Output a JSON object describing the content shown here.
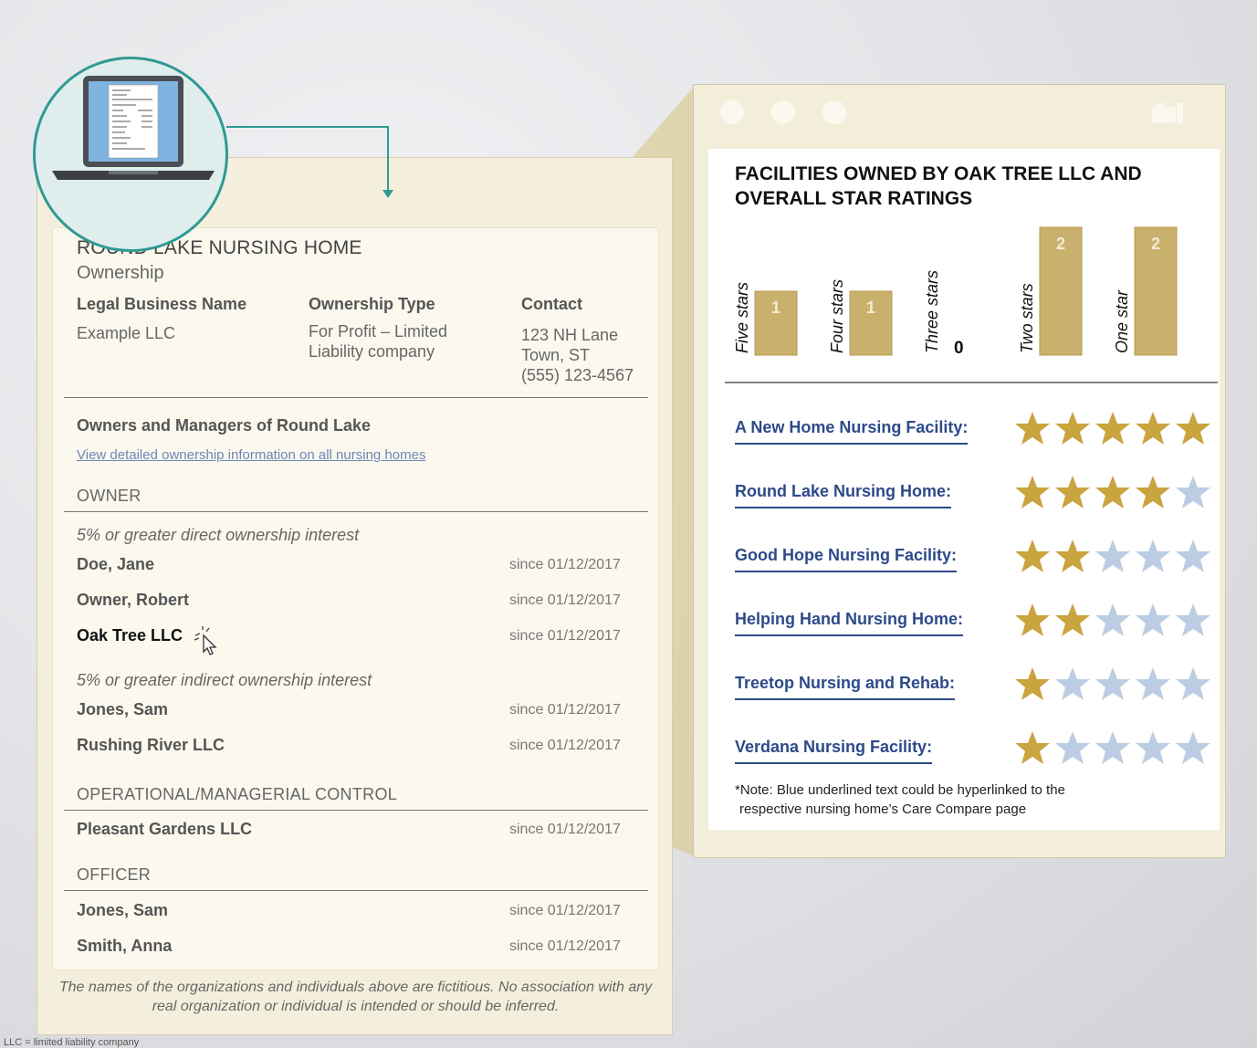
{
  "facility": {
    "title": "ROUND LAKE NURSING HOME",
    "section": "Ownership",
    "columns": [
      {
        "header": "Legal Business Name",
        "lines": [
          "Example LLC"
        ]
      },
      {
        "header": "Ownership Type",
        "lines": [
          "For Profit – Limited",
          "Liability company"
        ]
      },
      {
        "header": "Contact",
        "lines": [
          "123 NH Lane",
          "Town, ST",
          "(555) 123-4567"
        ]
      }
    ]
  },
  "owners_section": {
    "title": "Owners and Managers of Round Lake",
    "link": "View detailed ownership information on all nursing homes",
    "owner_heading": "OWNER",
    "direct_heading": "5% or greater direct ownership interest",
    "direct": [
      {
        "name": "Doe, Jane",
        "since": "since 01/12/2017"
      },
      {
        "name": "Owner, Robert",
        "since": "since 01/12/2017"
      },
      {
        "name": "Oak Tree LLC",
        "since": "since 01/12/2017"
      }
    ],
    "indirect_heading": "5% or greater indirect ownership interest",
    "indirect": [
      {
        "name": "Jones, Sam",
        "since": "since 01/12/2017"
      },
      {
        "name": "Rushing River LLC",
        "since": "since 01/12/2017"
      }
    ],
    "operational_heading": "OPERATIONAL/MANAGERIAL CONTROL",
    "operational": [
      {
        "name": "Pleasant Gardens LLC",
        "since": "since 01/12/2017"
      }
    ],
    "officer_heading": "OFFICER",
    "officers": [
      {
        "name": "Jones, Sam",
        "since": "since 01/12/2017"
      },
      {
        "name": "Smith, Anna",
        "since": "since 01/12/2017"
      }
    ]
  },
  "disclaimer": "The names of the organizations and individuals above are fictitious. No association with any real organization or individual is intended or should be inferred.",
  "footnote": "LLC = limited liability company",
  "popup": {
    "title": "FACILITIES OWNED BY OAK TREE LLC AND OVERALL STAR RATINGS",
    "facilities": [
      {
        "name": "A New Home Nursing Facility:",
        "rating": 5
      },
      {
        "name": "Round Lake Nursing Home:",
        "rating": 4
      },
      {
        "name": "Good Hope Nursing Facility:",
        "rating": 2
      },
      {
        "name": "Helping Hand Nursing Home:",
        "rating": 2
      },
      {
        "name": "Treetop Nursing and Rehab:",
        "rating": 1
      },
      {
        "name": "Verdana Nursing Facility:",
        "rating": 1
      }
    ],
    "note_lines": [
      "*Note: Blue underlined text could be hyperlinked to the",
      "respective nursing home’s Care Compare page"
    ]
  },
  "chart_data": {
    "type": "bar",
    "title": "FACILITIES OWNED BY OAK TREE LLC AND OVERALL STAR RATINGS",
    "categories": [
      "Five stars",
      "Four stars",
      "Three stars",
      "Two stars",
      "One star"
    ],
    "values": [
      1,
      1,
      0,
      2,
      2
    ],
    "value_labels": [
      "1",
      "1",
      "0",
      "2",
      "2"
    ],
    "ylim": [
      0,
      2
    ],
    "grid": false,
    "legend": "none"
  },
  "colors": {
    "bar": "#c9b06d",
    "link_blue": "#2c4a8a",
    "star_gold": "#c9a43f",
    "star_empty": "#bccde3",
    "teal": "#2f9a93"
  }
}
